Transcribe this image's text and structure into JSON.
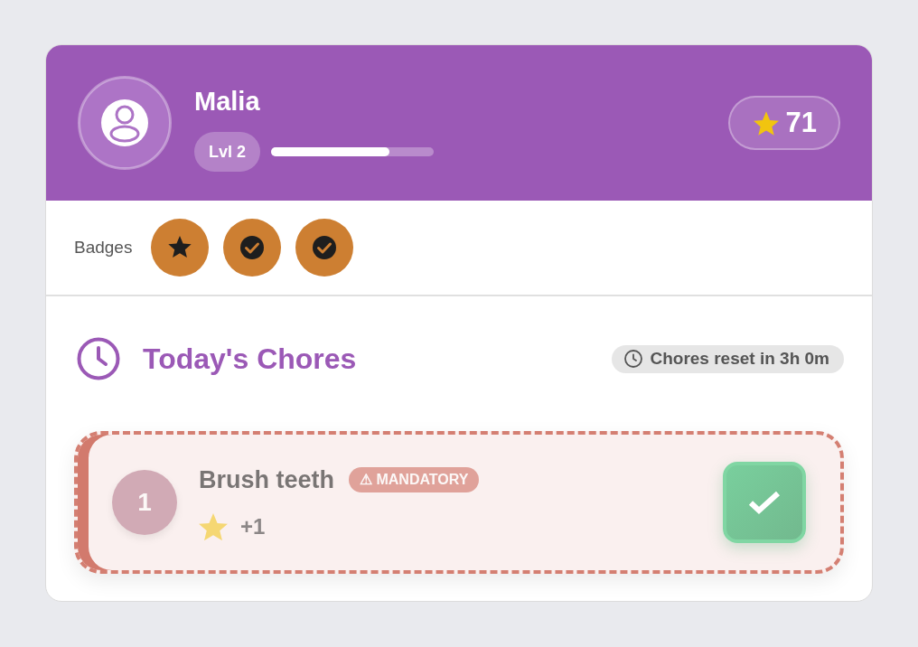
{
  "profile": {
    "name": "Malia",
    "level_label": "Lvl 2",
    "level": 0.73,
    "points": "71"
  },
  "badges": {
    "label": "Badges",
    "items": [
      {
        "kind": "star"
      },
      {
        "kind": "check"
      },
      {
        "kind": "check"
      }
    ]
  },
  "chores_header": {
    "title": "Today's Chores",
    "reset_note": "Chores reset in 3h 0m"
  },
  "chores": [
    {
      "number": "1",
      "title": "Brush teeth",
      "mandatory": true,
      "tag": "⚠ MANDATORY",
      "reward": "+1",
      "completed": true
    }
  ]
}
